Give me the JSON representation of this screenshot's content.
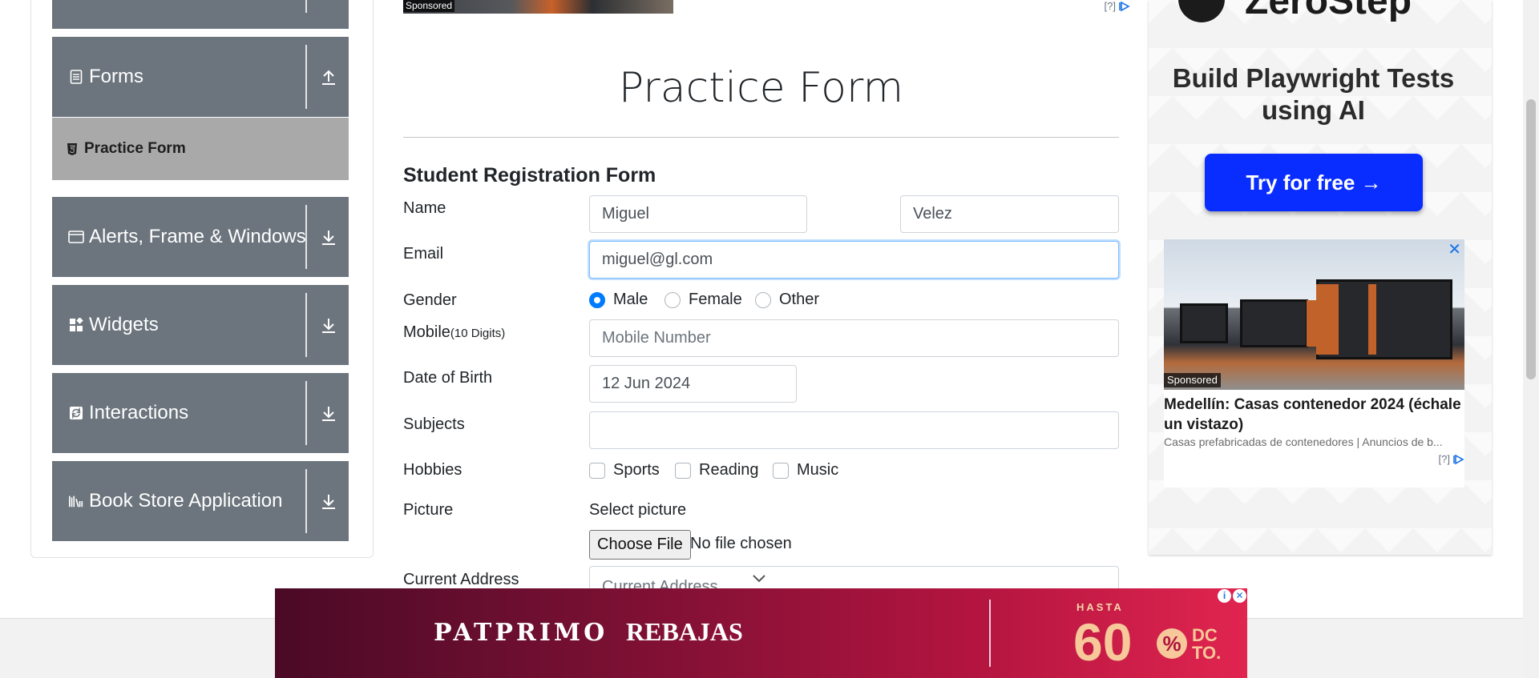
{
  "sidebar": {
    "categories": [
      {
        "label": "Forms",
        "icon": "document-icon",
        "arrow": "upload-arrow"
      },
      {
        "label": "Alerts, Frame & Windows",
        "icon": "window-icon",
        "arrow": "download-arrow"
      },
      {
        "label": "Widgets",
        "icon": "widgets-icon",
        "arrow": "download-arrow"
      },
      {
        "label": "Interactions",
        "icon": "interactions-icon",
        "arrow": "download-arrow"
      },
      {
        "label": "Book Store Application",
        "icon": "books-icon",
        "arrow": "download-arrow"
      }
    ],
    "active_item": {
      "label": "Practice Form",
      "icon": "html5-icon"
    }
  },
  "top_ad": {
    "sponsored": "Sponsored",
    "info": "[?]"
  },
  "form": {
    "page_title": "Practice Form",
    "heading": "Student Registration Form",
    "labels": {
      "name": "Name",
      "email": "Email",
      "gender": "Gender",
      "mobile": "Mobile",
      "mobile_hint": "(10 Digits)",
      "dob": "Date of Birth",
      "subjects": "Subjects",
      "hobbies": "Hobbies",
      "picture": "Picture",
      "address": "Current Address"
    },
    "first_name": "Miguel",
    "last_name": "Velez",
    "email": "miguel@gl.com",
    "gender_options": [
      "Male",
      "Female",
      "Other"
    ],
    "gender_selected": "Male",
    "mobile_placeholder": "Mobile Number",
    "dob": "12 Jun 2024",
    "subjects": "",
    "hobby_options": [
      "Sports",
      "Reading",
      "Music"
    ],
    "picture_label": "Select picture",
    "file_button": "Choose File",
    "file_status": "No file chosen",
    "address_placeholder": "Current Address"
  },
  "right_ad": {
    "brand": "ZeroStep",
    "tagline": "Build Playwright Tests using AI",
    "cta": "Try for free →",
    "card": {
      "sponsored": "Sponsored",
      "headline": "Medellín: Casas contenedor 2024 (échale un vistazo)",
      "description": "Casas prefabricadas de contenedores | Anuncios de b...",
      "info": "[?]",
      "close": "✕"
    }
  },
  "bottom_banner": {
    "brand": "PATPRIMO",
    "promo": "REBAJAS",
    "hasta": "HASTA",
    "percent": "60",
    "percent_sign": "%",
    "dcto_line1": "DC",
    "dcto_line2": "TO."
  },
  "colors": {
    "sidebar_bg": "#6c757d",
    "active_item_bg": "#a9a9a9",
    "cta_blue": "#0a2dff",
    "radio_checked": "#007bff"
  }
}
